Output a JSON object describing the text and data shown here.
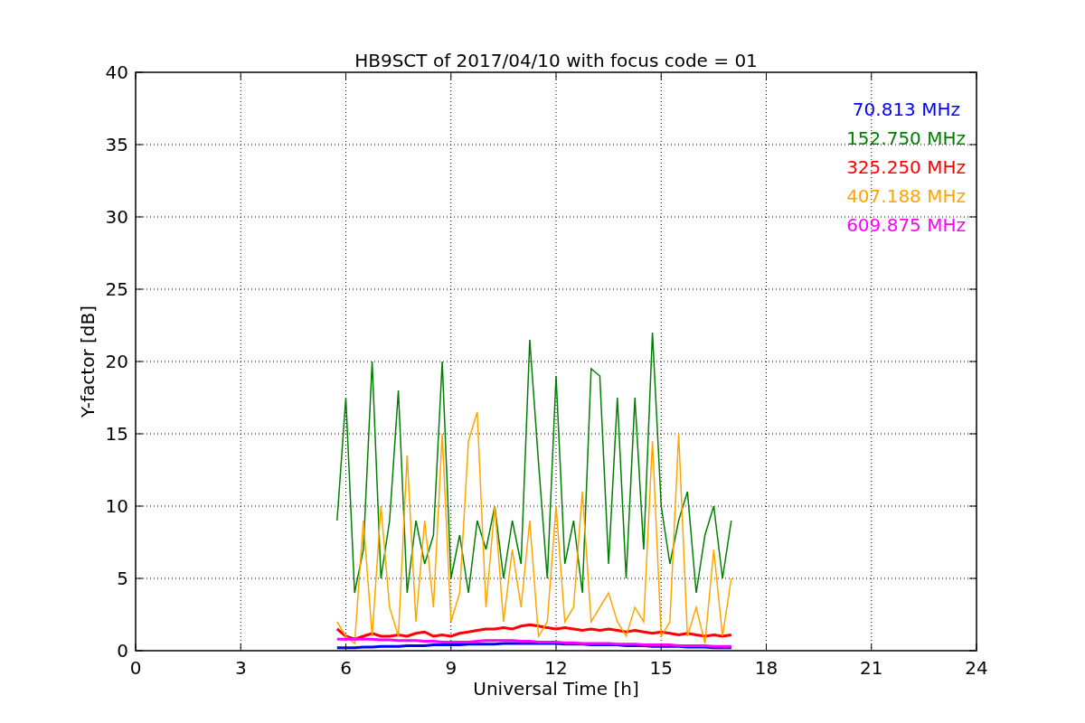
{
  "figure": {
    "chart_data": {
      "type": "line",
      "grid": true,
      "title": "HB9SCT of 2017/04/10 with focus code = 01",
      "xlabel": "Universal Time [h]",
      "ylabel": "Y-factor [dB]",
      "xlim": [
        0,
        24
      ],
      "ylim": [
        0,
        40
      ],
      "xticks": [
        0,
        3,
        6,
        9,
        12,
        15,
        18,
        21,
        24
      ],
      "yticks": [
        0,
        5,
        10,
        15,
        20,
        25,
        30,
        35,
        40
      ],
      "x": [
        5.75,
        6,
        6.25,
        6.5,
        6.75,
        7,
        7.25,
        7.5,
        7.75,
        8,
        8.25,
        8.5,
        8.75,
        9,
        9.25,
        9.5,
        9.75,
        10,
        10.25,
        10.5,
        10.75,
        11,
        11.25,
        11.5,
        11.75,
        12,
        12.25,
        12.5,
        12.75,
        13,
        13.25,
        13.5,
        13.75,
        14,
        14.25,
        14.5,
        14.75,
        15,
        15.25,
        15.5,
        15.75,
        16,
        16.25,
        16.5,
        16.75,
        17
      ],
      "series": [
        {
          "name": "70.813 MHz",
          "color": "#0000ff",
          "values": [
            0.2,
            0.2,
            0.2,
            0.25,
            0.25,
            0.3,
            0.3,
            0.3,
            0.35,
            0.35,
            0.35,
            0.4,
            0.4,
            0.4,
            0.4,
            0.45,
            0.45,
            0.45,
            0.45,
            0.5,
            0.5,
            0.5,
            0.5,
            0.5,
            0.5,
            0.5,
            0.45,
            0.45,
            0.45,
            0.4,
            0.4,
            0.4,
            0.4,
            0.35,
            0.35,
            0.35,
            0.3,
            0.3,
            0.3,
            0.3,
            0.25,
            0.25,
            0.25,
            0.2,
            0.2,
            0.2
          ]
        },
        {
          "name": "152.750 MHz",
          "color": "#008000",
          "values": [
            9,
            17.5,
            4,
            7,
            20,
            5,
            9,
            18,
            4,
            9,
            6,
            8,
            20,
            5,
            8,
            4,
            9,
            7,
            10,
            5,
            9,
            6,
            21.5,
            13,
            5,
            19,
            6,
            9,
            4,
            19.5,
            19,
            6,
            17.5,
            5,
            17.5,
            7,
            22,
            10,
            6,
            9,
            11,
            4,
            8,
            10,
            5,
            9
          ]
        },
        {
          "name": "325.250 MHz",
          "color": "#ff0000",
          "values": [
            1.5,
            1,
            0.8,
            1,
            1.2,
            1,
            1,
            1.1,
            1,
            1.2,
            1.3,
            1,
            1.1,
            1,
            1.2,
            1.3,
            1.4,
            1.5,
            1.5,
            1.6,
            1.5,
            1.7,
            1.8,
            1.7,
            1.6,
            1.5,
            1.6,
            1.5,
            1.4,
            1.5,
            1.4,
            1.5,
            1.4,
            1.3,
            1.4,
            1.3,
            1.2,
            1.3,
            1.2,
            1.1,
            1.2,
            1.1,
            1,
            1.1,
            1,
            1.1
          ]
        },
        {
          "name": "407.188 MHz",
          "color": "#ffa500",
          "values": [
            2,
            1,
            0.5,
            9,
            1,
            10,
            3,
            1,
            13.5,
            2,
            9,
            3,
            15,
            2,
            4,
            14.5,
            16.5,
            3,
            10,
            2,
            7,
            3,
            9,
            1,
            2,
            10,
            2,
            3,
            11,
            2,
            3,
            4,
            2,
            1,
            3,
            2,
            14.5,
            1,
            2,
            15,
            1,
            3,
            0.5,
            7,
            1,
            5
          ]
        },
        {
          "name": "609.875 MHz",
          "color": "#ff00ff",
          "values": [
            0.8,
            0.8,
            0.8,
            0.8,
            0.8,
            0.75,
            0.75,
            0.7,
            0.7,
            0.7,
            0.65,
            0.65,
            0.6,
            0.6,
            0.6,
            0.6,
            0.65,
            0.7,
            0.7,
            0.7,
            0.7,
            0.65,
            0.65,
            0.6,
            0.6,
            0.6,
            0.55,
            0.55,
            0.5,
            0.5,
            0.5,
            0.5,
            0.45,
            0.45,
            0.45,
            0.4,
            0.4,
            0.4,
            0.4,
            0.35,
            0.35,
            0.35,
            0.35,
            0.3,
            0.3,
            0.3
          ]
        }
      ]
    }
  }
}
